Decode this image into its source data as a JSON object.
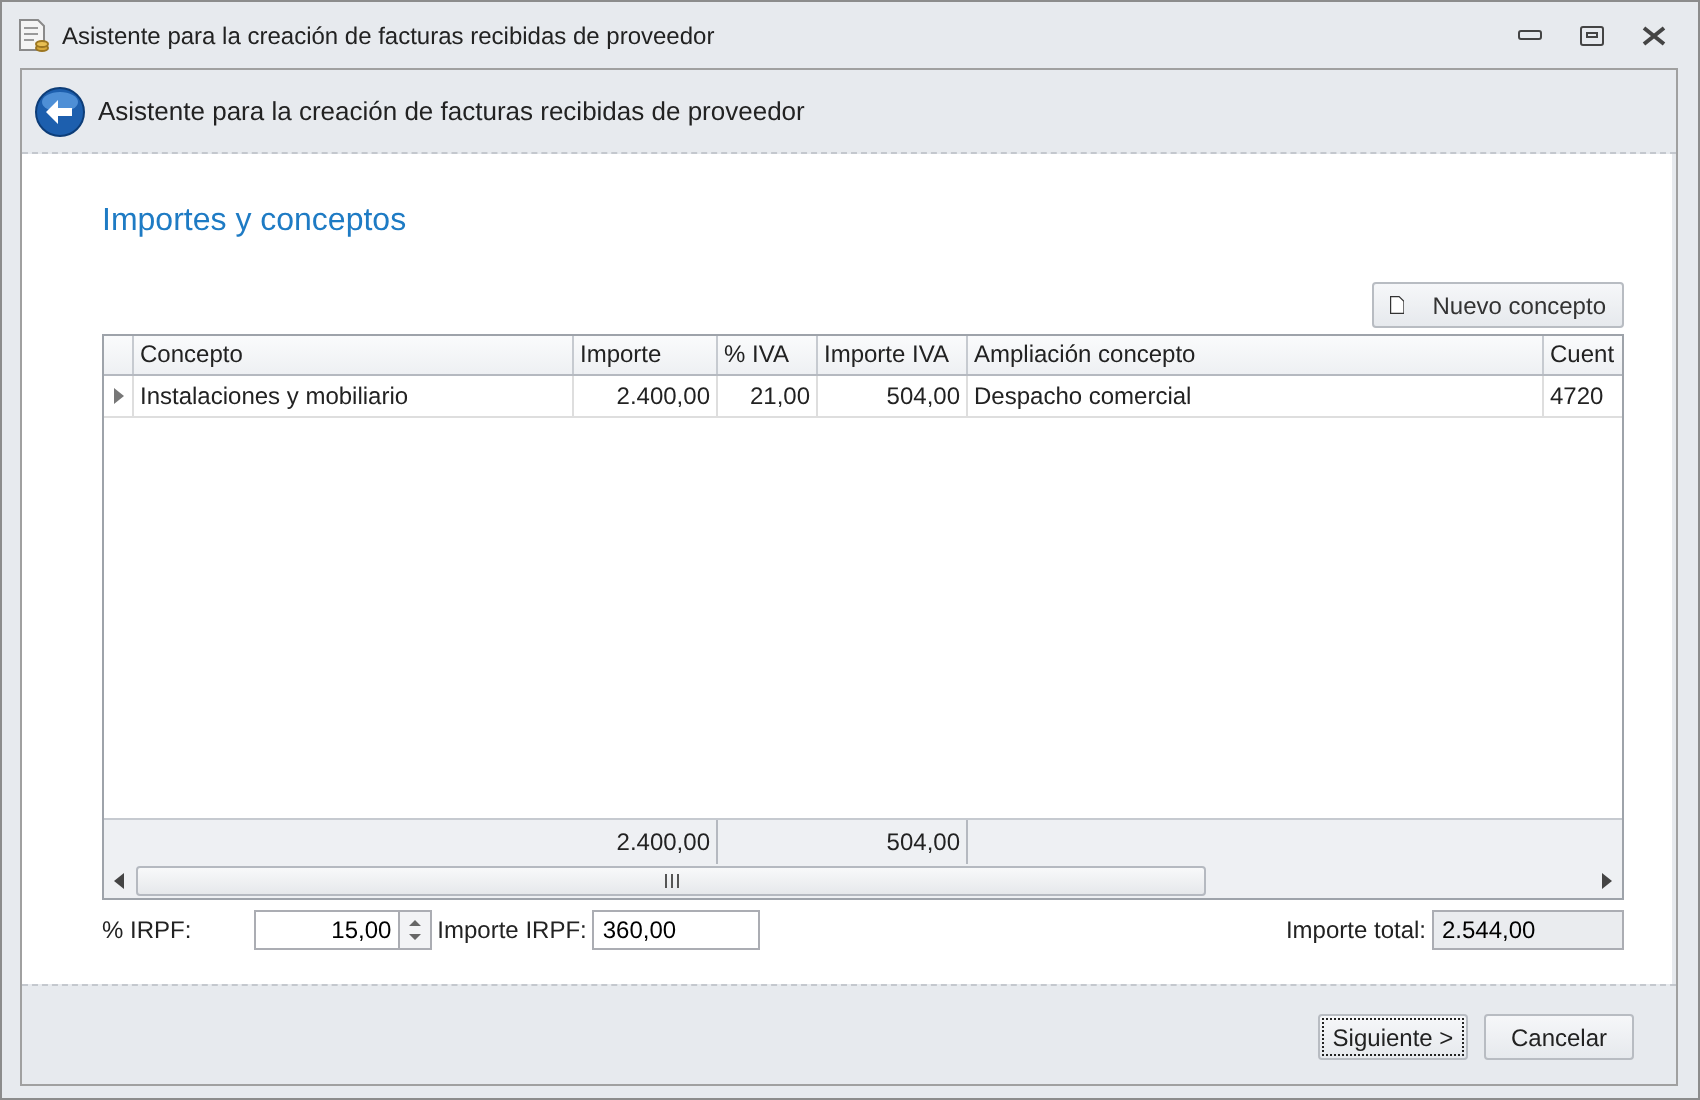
{
  "window": {
    "title": "Asistente para la creación de facturas recibidas de proveedor"
  },
  "header": {
    "title": "Asistente para la creación de facturas recibidas de proveedor"
  },
  "section_title": "Importes y conceptos",
  "new_button": {
    "label": "Nuevo concepto"
  },
  "grid": {
    "columns": [
      {
        "label": "Concepto"
      },
      {
        "label": "Importe",
        "total": "2.400,00"
      },
      {
        "label": "% IVA"
      },
      {
        "label": "Importe IVA",
        "total": "504,00"
      },
      {
        "label": "Ampliación concepto"
      },
      {
        "label": "Cuent"
      }
    ],
    "rows": [
      {
        "current": true,
        "cells": [
          "Instalaciones y mobiliario",
          "2.400,00",
          "21,00",
          "504,00",
          "Despacho comercial",
          "4720"
        ]
      }
    ]
  },
  "irpf": {
    "label": "% IRPF:",
    "value": "15,00"
  },
  "importe_irpf": {
    "label": "Importe IRPF:",
    "value": "360,00"
  },
  "importe_total": {
    "label": "Importe total:",
    "value": "2.544,00",
    "disabled": true
  },
  "buttons": [
    {
      "label": "Siguiente >",
      "focused": true
    },
    {
      "label": "Cancelar",
      "focused": false
    }
  ]
}
